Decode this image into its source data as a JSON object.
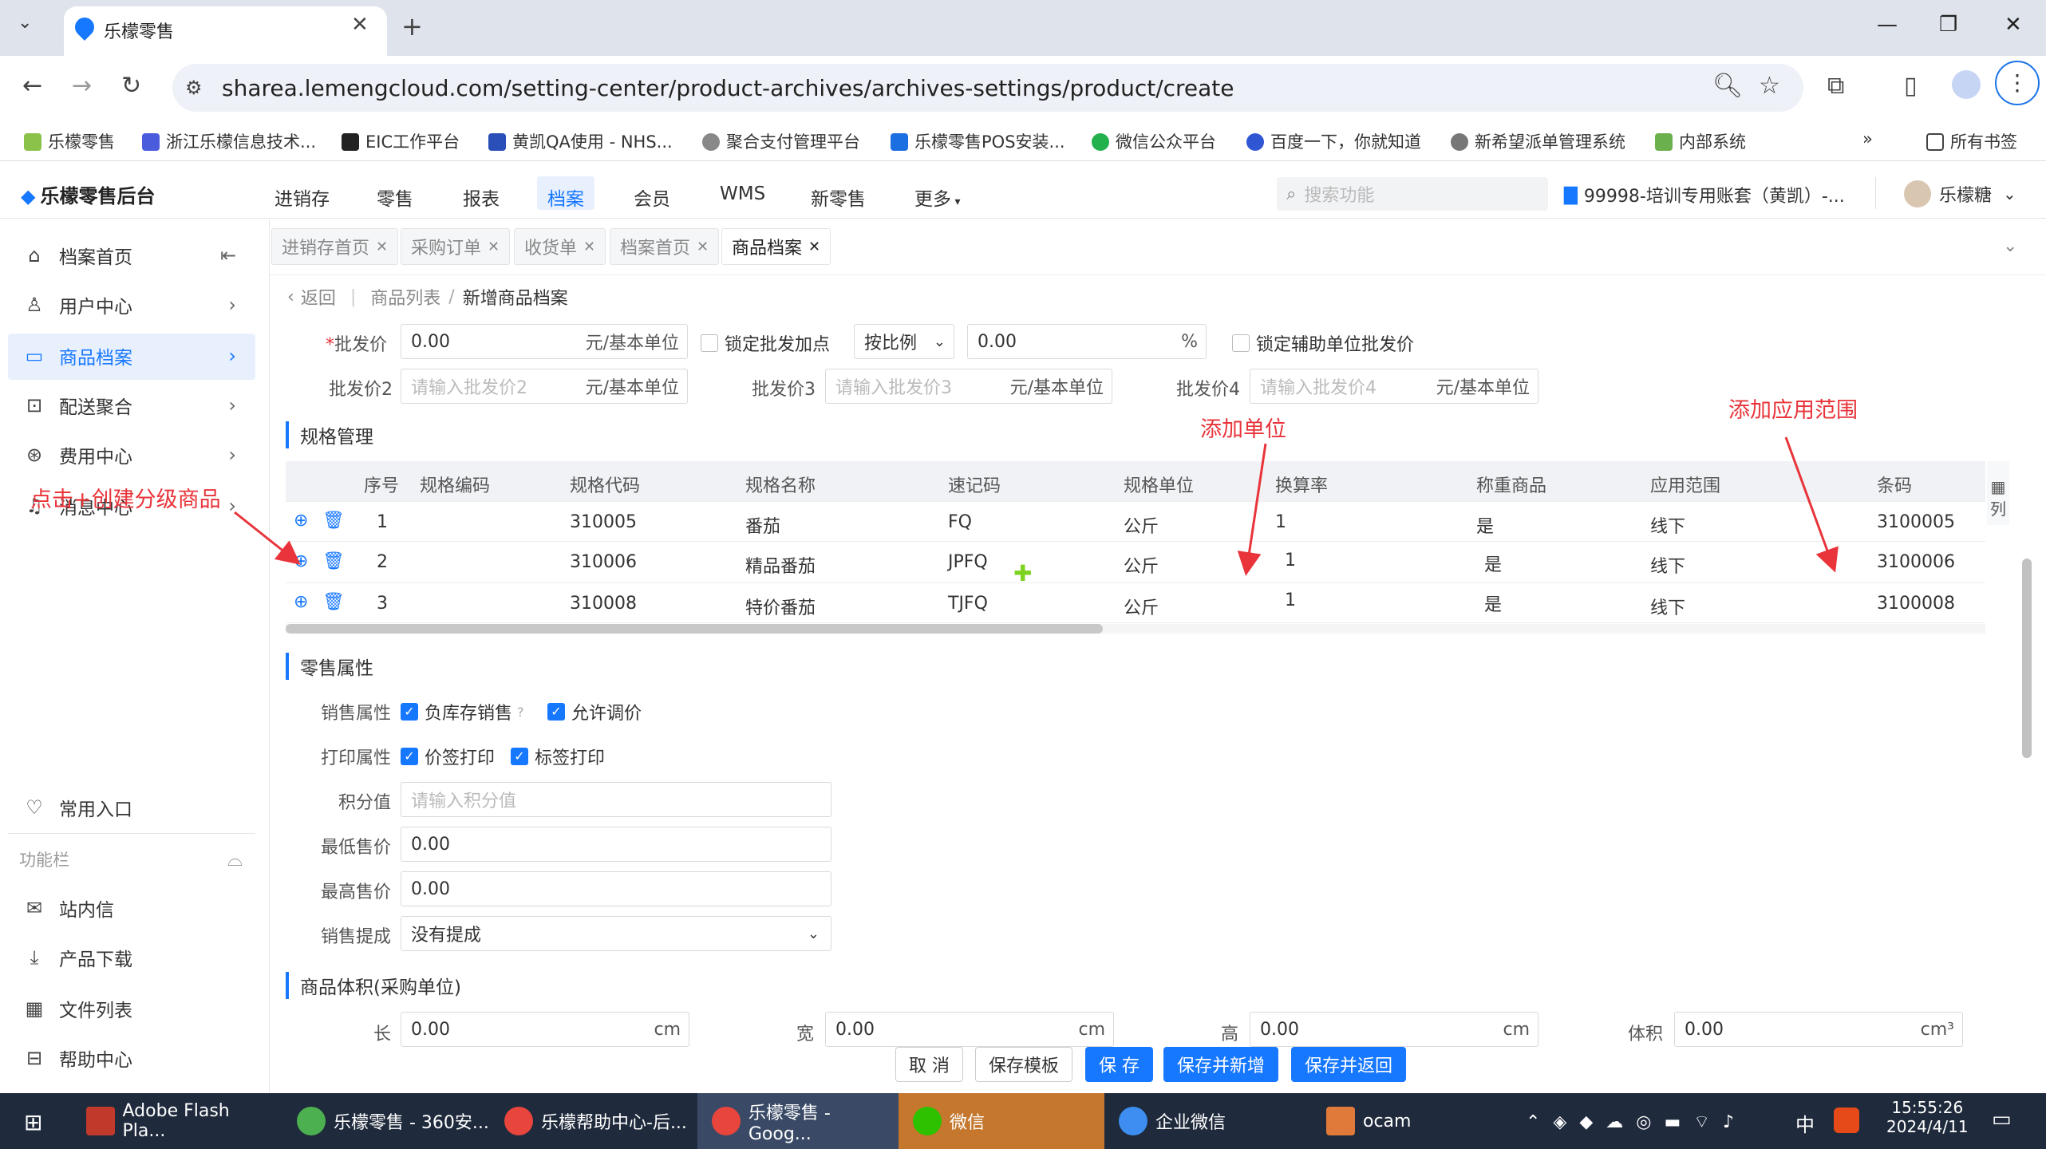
{
  "browser": {
    "tab_title": "乐檬零售",
    "url": "sharea.lemengcloud.com/setting-center/product-archives/archives-settings/product/create",
    "bookmarks": [
      "乐檬零售",
      "浙江乐檬信息技术...",
      "EIC工作平台",
      "黄凯QA使用 - NHS...",
      "聚合支付管理平台",
      "乐檬零售POS安装...",
      "微信公众平台",
      "百度一下，你就知道",
      "新希望派单管理系统",
      "内部系统",
      "所有书签"
    ]
  },
  "app": {
    "logo": "乐檬零售后台",
    "nav": [
      "进销存",
      "零售",
      "报表",
      "档案",
      "会员",
      "WMS",
      "新零售",
      "更多"
    ],
    "active_nav": "档案",
    "search_placeholder": "搜索功能",
    "account": "99998-培训专用账套（黄凯）-...",
    "user": "乐檬糖"
  },
  "sidebar": {
    "items": [
      {
        "label": "档案首页",
        "icon": "home-icon"
      },
      {
        "label": "用户中心",
        "icon": "user-icon"
      },
      {
        "label": "商品档案",
        "icon": "product-icon"
      },
      {
        "label": "配送聚合",
        "icon": "delivery-icon"
      },
      {
        "label": "费用中心",
        "icon": "fee-icon"
      },
      {
        "label": "消息中心",
        "icon": "bell-icon"
      }
    ],
    "common_entry": "常用入口",
    "function_bar": "功能栏",
    "bottom_items": [
      "站内信",
      "产品下载",
      "文件列表",
      "帮助中心"
    ]
  },
  "page_tabs": [
    "进销存首页",
    "采购订单",
    "收货单",
    "档案首页",
    "商品档案"
  ],
  "breadcrumb": {
    "back": "返回",
    "parent": "商品列表",
    "current": "新增商品档案"
  },
  "wholesale": {
    "label": "批发价",
    "value": "0.00",
    "unit": "元/基本单位",
    "lock_label": "锁定批发加点",
    "mode": "按比例",
    "percent_value": "0.00",
    "percent_unit": "%",
    "lock_aux_label": "锁定辅助单位批发价",
    "price2_label": "批发价2",
    "price2_ph": "请输入批发价2",
    "price3_label": "批发价3",
    "price3_ph": "请输入批发价3",
    "price4_label": "批发价4",
    "price4_ph": "请输入批发价4"
  },
  "spec": {
    "section": "规格管理",
    "columns": [
      "序号",
      "规格编码",
      "规格代码",
      "规格名称",
      "速记码",
      "规格单位",
      "换算率",
      "称重商品",
      "应用范围",
      "条码"
    ],
    "col_toggle": "列",
    "rows": [
      {
        "no": "1",
        "code": "310005",
        "name": "番茄",
        "mnemonic": "FQ",
        "unit": "公斤",
        "rate": "1",
        "weigh": "是",
        "scope": "线下",
        "barcode": "3100005"
      },
      {
        "no": "2",
        "code": "310006",
        "name": "精品番茄",
        "mnemonic": "JPFQ",
        "unit": "公斤",
        "rate": "1",
        "weigh": "是",
        "scope": "线下",
        "barcode": "3100006"
      },
      {
        "no": "3",
        "code": "310008",
        "name": "特价番茄",
        "mnemonic": "TJFQ",
        "unit": "公斤",
        "rate": "1",
        "weigh": "是",
        "scope": "线下",
        "barcode": "3100008"
      }
    ]
  },
  "annotations": {
    "create_grade": "点击+创建分级商品",
    "add_unit": "添加单位",
    "add_scope": "添加应用范围"
  },
  "retail": {
    "section": "零售属性",
    "sales_attr_label": "销售属性",
    "neg_stock": "负库存销售",
    "allow_price": "允许调价",
    "print_attr_label": "打印属性",
    "price_print": "价签打印",
    "label_print": "标签打印",
    "points_label": "积分值",
    "points_ph": "请输入积分值",
    "min_price_label": "最低售价",
    "min_price": "0.00",
    "max_price_label": "最高售价",
    "max_price": "0.00",
    "commission_label": "销售提成",
    "commission": "没有提成"
  },
  "volume": {
    "section": "商品体积(采购单位)",
    "len_label": "长",
    "len": "0.00",
    "wid_label": "宽",
    "wid": "0.00",
    "hei_label": "高",
    "hei": "0.00",
    "unit": "cm",
    "vol_label": "体积",
    "vol": "0.00",
    "vol_unit": "cm³"
  },
  "actions": {
    "cancel": "取 消",
    "save_template": "保存模板",
    "save": "保 存",
    "save_new": "保存并新增",
    "save_return": "保存并返回"
  },
  "taskbar": {
    "items": [
      "Adobe Flash Pla...",
      "乐檬零售 - 360安...",
      "乐檬帮助中心-后...",
      "乐檬零售 - Goog...",
      "微信",
      "企业微信",
      "ocam"
    ],
    "time": "15:55:26",
    "date": "2024/4/11",
    "ime": "中"
  },
  "colors": {
    "accent": "#1677ff",
    "annotation": "#e8343a"
  }
}
